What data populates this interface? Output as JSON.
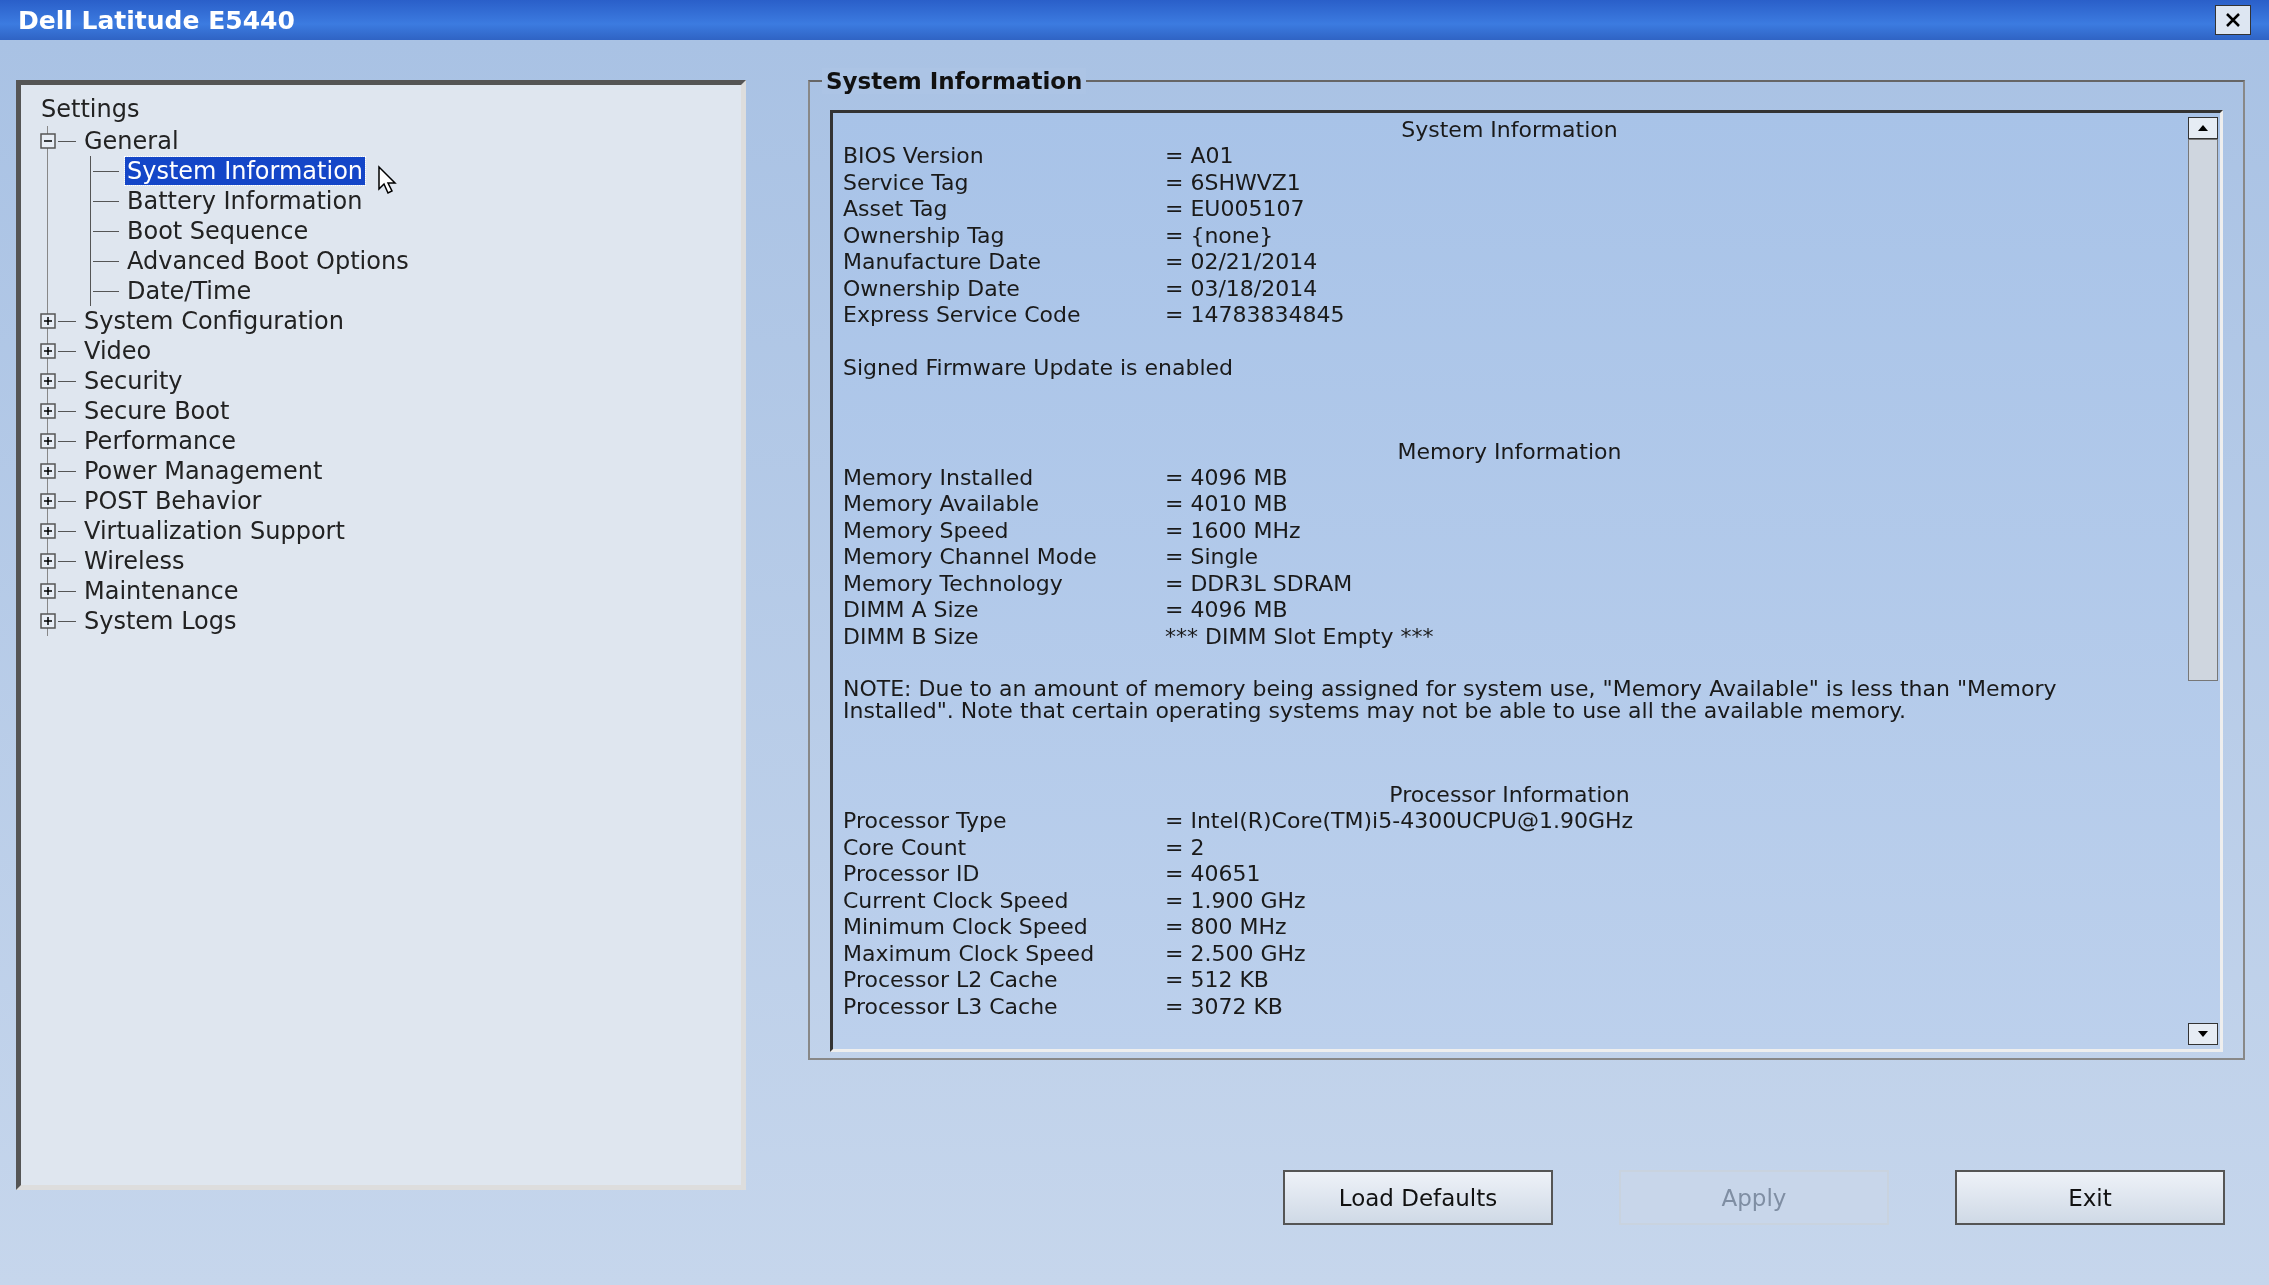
{
  "window": {
    "title": "Dell Latitude E5440"
  },
  "tree": {
    "root": "Settings",
    "items": [
      {
        "label": "General",
        "expanded": true,
        "selected": false,
        "children": [
          {
            "label": "System Information",
            "selected": true
          },
          {
            "label": "Battery Information",
            "selected": false
          },
          {
            "label": "Boot Sequence",
            "selected": false
          },
          {
            "label": "Advanced Boot Options",
            "selected": false
          },
          {
            "label": "Date/Time",
            "selected": false
          }
        ]
      },
      {
        "label": "System Configuration",
        "expanded": false,
        "selected": false
      },
      {
        "label": "Video",
        "expanded": false,
        "selected": false
      },
      {
        "label": "Security",
        "expanded": false,
        "selected": false
      },
      {
        "label": "Secure Boot",
        "expanded": false,
        "selected": false
      },
      {
        "label": "Performance",
        "expanded": false,
        "selected": false
      },
      {
        "label": "Power Management",
        "expanded": false,
        "selected": false
      },
      {
        "label": "POST Behavior",
        "expanded": false,
        "selected": false
      },
      {
        "label": "Virtualization Support",
        "expanded": false,
        "selected": false
      },
      {
        "label": "Wireless",
        "expanded": false,
        "selected": false
      },
      {
        "label": "Maintenance",
        "expanded": false,
        "selected": false
      },
      {
        "label": "System Logs",
        "expanded": false,
        "selected": false
      }
    ]
  },
  "panel": {
    "title": "System Information",
    "sections": [
      {
        "heading": "System Information",
        "rows": [
          {
            "label": "BIOS Version",
            "value": "= A01"
          },
          {
            "label": "Service Tag",
            "value": "= 6SHWVZ1"
          },
          {
            "label": "Asset Tag",
            "value": "= EU005107"
          },
          {
            "label": "Ownership Tag",
            "value": "= {none}"
          },
          {
            "label": "Manufacture Date",
            "value": "= 02/21/2014"
          },
          {
            "label": "Ownership Date",
            "value": "= 03/18/2014"
          },
          {
            "label": "Express Service Code",
            "value": "= 14783834845"
          }
        ],
        "note": "Signed Firmware Update is enabled"
      },
      {
        "heading": "Memory Information",
        "rows": [
          {
            "label": "Memory Installed",
            "value": "= 4096 MB"
          },
          {
            "label": "Memory Available",
            "value": "= 4010 MB"
          },
          {
            "label": "Memory Speed",
            "value": "= 1600 MHz"
          },
          {
            "label": "Memory Channel Mode",
            "value": "= Single"
          },
          {
            "label": "Memory Technology",
            "value": "= DDR3L SDRAM"
          },
          {
            "label": "DIMM A Size",
            "value": "= 4096 MB"
          },
          {
            "label": "DIMM B Size",
            "value": "*** DIMM Slot Empty ***"
          }
        ],
        "note": "NOTE: Due to an amount of memory being assigned for system use, \"Memory Available\" is less than \"Memory Installed\". Note that certain operating systems may not be able to use all the available memory."
      },
      {
        "heading": "Processor Information",
        "rows": [
          {
            "label": "Processor Type",
            "value": "= Intel(R)Core(TM)i5-4300UCPU@1.90GHz"
          },
          {
            "label": "Core Count",
            "value": "= 2"
          },
          {
            "label": "Processor ID",
            "value": "= 40651"
          },
          {
            "label": "Current Clock Speed",
            "value": "= 1.900 GHz"
          },
          {
            "label": "Minimum Clock Speed",
            "value": "= 800 MHz"
          },
          {
            "label": "Maximum Clock Speed",
            "value": "= 2.500 GHz"
          },
          {
            "label": "Processor L2 Cache",
            "value": "= 512 KB"
          },
          {
            "label": "Processor L3 Cache",
            "value": "= 3072 KB"
          }
        ]
      }
    ]
  },
  "buttons": [
    {
      "label": "Load Defaults",
      "disabled": false
    },
    {
      "label": "Apply",
      "disabled": true
    },
    {
      "label": "Exit",
      "disabled": false
    }
  ]
}
